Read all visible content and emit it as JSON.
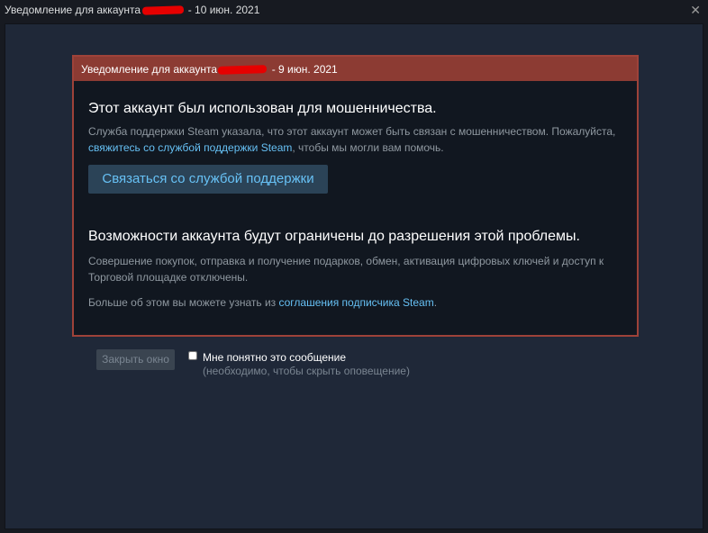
{
  "window": {
    "title_prefix": "Уведомление для аккаунта",
    "title_suffix": "- 10 июн. 2021",
    "close_glyph": "✕"
  },
  "notice": {
    "header_prefix": "Уведомление для аккаунта",
    "header_suffix": "- 9 июн. 2021",
    "heading_1": "Этот аккаунт был использован для мошенничества.",
    "para_1_a": "Служба поддержки Steam указала, что этот аккаунт может быть связан с мошенничеством. Пожалуйста,",
    "para_1_link": "свяжитесь со службой поддержки Steam",
    "para_1_b": ", чтобы мы могли вам помочь.",
    "support_button": "Связаться со службой поддержки",
    "heading_2": "Возможности аккаунта будут ограничены до разрешения этой проблемы.",
    "para_2": "Совершение покупок, отправка и получение подарков, обмен, активация цифровых ключей и доступ к Торговой площадке отключены.",
    "para_3_a": "Больше об этом вы можете узнать из",
    "para_3_link": "соглашения подписчика Steam",
    "para_3_b": "."
  },
  "footer": {
    "close_window_button": "Закрыть окно",
    "ack_label": "Мне понятно это сообщение",
    "ack_sub": "(необходимо, чтобы скрыть оповещение)",
    "ack_checked": false
  },
  "colors": {
    "background": "#1f2838",
    "warning_border": "#9e4239",
    "warning_header": "#8c3b33",
    "link": "#66c0f4",
    "button_bg": "#2b4357"
  }
}
